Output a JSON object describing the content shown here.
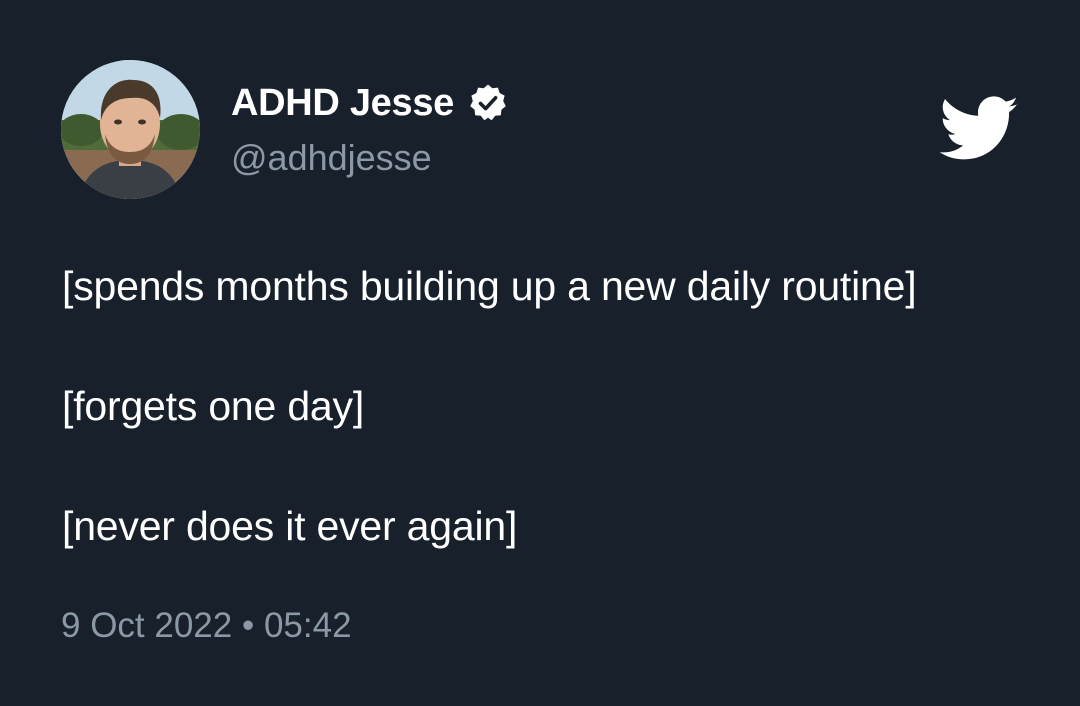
{
  "author": {
    "display_name": "ADHD Jesse",
    "handle": "@adhdjesse",
    "verified": true
  },
  "tweet": {
    "lines": [
      "[spends months building up a new daily routine]",
      "[forgets one day]",
      "[never does it ever again]"
    ],
    "date": "9 Oct 2022",
    "separator": "•",
    "time": "05:42"
  },
  "icons": {
    "logo": "twitter-bird-icon",
    "verified": "verified-badge-icon"
  },
  "colors": {
    "background": "#17202b",
    "text_primary": "#ffffff",
    "text_secondary": "#8b98a5"
  }
}
